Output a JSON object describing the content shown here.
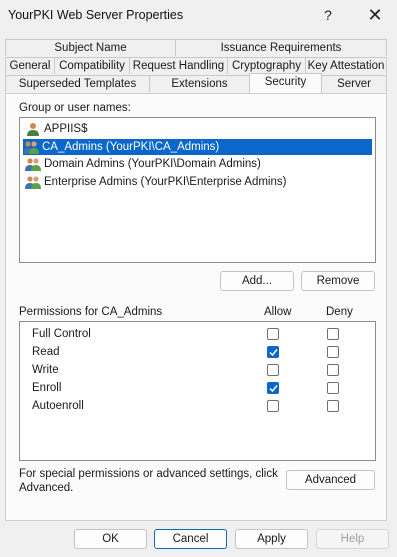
{
  "window": {
    "title": "YourPKI Web Server Properties",
    "help_glyph": "?",
    "close_glyph": "✕"
  },
  "tabs": {
    "row1": [
      "Subject Name",
      "Issuance Requirements"
    ],
    "row2": [
      "General",
      "Compatibility",
      "Request Handling",
      "Cryptography",
      "Key Attestation"
    ],
    "row3": [
      "Superseded Templates",
      "Extensions",
      "Security",
      "Server"
    ],
    "active": "Security"
  },
  "security": {
    "group_label": "Group or user names:",
    "principals": [
      {
        "name": "APPIIS$",
        "icon": "user-icon",
        "selected": false
      },
      {
        "name": "CA_Admins (YourPKI\\CA_Admins)",
        "icon": "group-icon",
        "selected": true
      },
      {
        "name": "Domain Admins (YourPKI\\Domain Admins)",
        "icon": "group-icon",
        "selected": false
      },
      {
        "name": "Enterprise Admins (YourPKI\\Enterprise Admins)",
        "icon": "group-icon",
        "selected": false
      }
    ],
    "add_label": "Add...",
    "remove_label": "Remove",
    "permissions_label": "Permissions for CA_Admins",
    "allow_header": "Allow",
    "deny_header": "Deny",
    "permissions": [
      {
        "name": "Full Control",
        "allow": false,
        "deny": false
      },
      {
        "name": "Read",
        "allow": true,
        "deny": false
      },
      {
        "name": "Write",
        "allow": false,
        "deny": false
      },
      {
        "name": "Enroll",
        "allow": true,
        "deny": false
      },
      {
        "name": "Autoenroll",
        "allow": false,
        "deny": false
      }
    ],
    "advanced_text_line1": "For special permissions or advanced settings, click",
    "advanced_text_line2": "Advanced.",
    "advanced_label": "Advanced"
  },
  "footer": {
    "ok": "OK",
    "cancel": "Cancel",
    "apply": "Apply",
    "help": "Help"
  },
  "colors": {
    "accent": "#0b67c9",
    "selection": "#0b67c9"
  }
}
